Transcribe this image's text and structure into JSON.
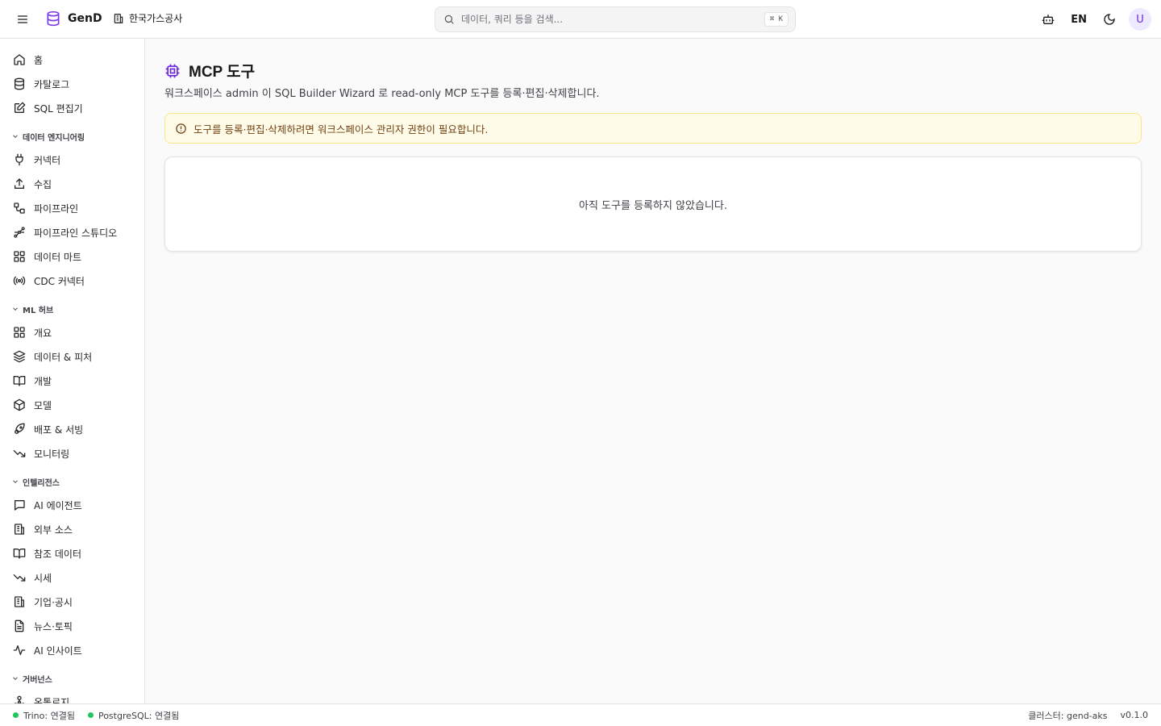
{
  "header": {
    "app_name": "GenD",
    "org_name": "한국가스공사",
    "search_placeholder": "데이터, 쿼리 등을 검색...",
    "search_shortcut": "⌘ K",
    "lang": "EN",
    "avatar_initial": "U"
  },
  "sidebar": {
    "top_items": [
      {
        "label": "홈",
        "icon": "home-icon"
      },
      {
        "label": "카탈로그",
        "icon": "database-icon"
      },
      {
        "label": "SQL 편집기",
        "icon": "edit-icon"
      }
    ],
    "sections": [
      {
        "title": "데이터 엔지니어링",
        "items": [
          {
            "label": "커넥터",
            "icon": "plug-icon"
          },
          {
            "label": "수집",
            "icon": "upload-icon"
          },
          {
            "label": "파이프라인",
            "icon": "workflow-icon"
          },
          {
            "label": "파이프라인 스튜디오",
            "icon": "spline-icon"
          },
          {
            "label": "데이터 마트",
            "icon": "grid-icon"
          },
          {
            "label": "CDC 커넥터",
            "icon": "radio-icon"
          }
        ]
      },
      {
        "title": "ML 허브",
        "items": [
          {
            "label": "개요",
            "icon": "grid-icon"
          },
          {
            "label": "데이터 & 피처",
            "icon": "layers-icon"
          },
          {
            "label": "개발",
            "icon": "book-open-icon"
          },
          {
            "label": "모델",
            "icon": "box-icon"
          },
          {
            "label": "배포 & 서빙",
            "icon": "rocket-icon"
          },
          {
            "label": "모니터링",
            "icon": "trending-down-icon"
          }
        ]
      },
      {
        "title": "인텔리전스",
        "items": [
          {
            "label": "AI 에이전트",
            "icon": "message-icon"
          },
          {
            "label": "외부 소스",
            "icon": "building-icon"
          },
          {
            "label": "참조 데이터",
            "icon": "book-open-icon"
          },
          {
            "label": "시세",
            "icon": "trending-down-icon"
          },
          {
            "label": "기업·공시",
            "icon": "building-icon"
          },
          {
            "label": "뉴스·토픽",
            "icon": "file-text-icon"
          },
          {
            "label": "AI 인사이트",
            "icon": "activity-icon"
          }
        ]
      },
      {
        "title": "거버넌스",
        "items": [
          {
            "label": "온톨로지",
            "icon": "network-icon"
          }
        ]
      }
    ]
  },
  "main": {
    "title": "MCP 도구",
    "description": "워크스페이스 admin 이 SQL Builder Wizard 로 read-only MCP 도구를 등록·편집·삭제합니다.",
    "alert": "도구를 등록·편집·삭제하려면 워크스페이스 관리자 권한이 필요합니다.",
    "empty_text": "아직 도구를 등록하지 않았습니다."
  },
  "statusbar": {
    "trino": "Trino: 연결됨",
    "postgres": "PostgreSQL: 연결됨",
    "cluster": "클러스터: gend-aks",
    "version": "v0.1.0"
  },
  "colors": {
    "accent": "#6d28d9",
    "status_ok": "#22c55e",
    "alert_bg": "#fefce8",
    "alert_border": "#fde68a"
  }
}
